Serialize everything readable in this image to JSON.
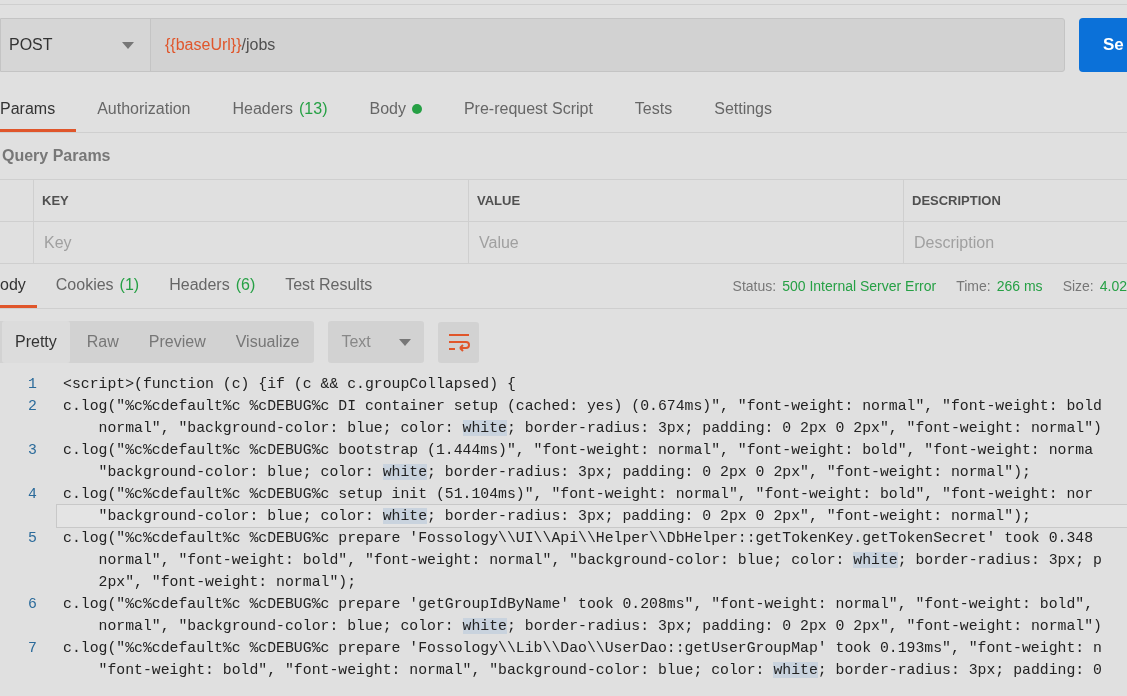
{
  "request": {
    "method": "POST",
    "url_variable": "{{baseUrl}}",
    "url_path": "/jobs",
    "send_label": "Se"
  },
  "request_tabs": [
    {
      "label": "Params",
      "selected": true
    },
    {
      "label": "Authorization",
      "selected": false
    },
    {
      "label": "Headers",
      "count": "(13)",
      "selected": false
    },
    {
      "label": "Body",
      "dot": true,
      "selected": false
    },
    {
      "label": "Pre-request Script",
      "selected": false
    },
    {
      "label": "Tests",
      "selected": false
    },
    {
      "label": "Settings",
      "selected": false
    }
  ],
  "query_params": {
    "title": "Query Params",
    "columns": [
      "KEY",
      "VALUE",
      "DESCRIPTION"
    ],
    "placeholders": [
      "Key",
      "Value",
      "Description"
    ]
  },
  "response_tabs": [
    {
      "label": "ody",
      "selected": true
    },
    {
      "label": "Cookies",
      "count": "(1)",
      "selected": false
    },
    {
      "label": "Headers",
      "count": "(6)",
      "selected": false
    },
    {
      "label": "Test Results",
      "selected": false
    }
  ],
  "status": [
    {
      "label": "Status:",
      "value": "500 Internal Server Error"
    },
    {
      "label": "Time:",
      "value": "266 ms"
    },
    {
      "label": "Size:",
      "value": "4.02"
    }
  ],
  "view_modes": [
    {
      "label": "Pretty",
      "selected": true
    },
    {
      "label": "Raw",
      "selected": false
    },
    {
      "label": "Preview",
      "selected": false
    },
    {
      "label": "Visualize",
      "selected": false
    }
  ],
  "format": "Text",
  "code": [
    {
      "number": "1",
      "rows": [
        {
          "parts": [
            "<script>(function (c) {if (c && c.groupCollapsed) {"
          ]
        }
      ]
    },
    {
      "number": "2",
      "rows": [
        {
          "parts": [
            "c.log(\"%c%cdefault%c %cDEBUG%c DI container setup (cached: yes) (0.674ms)\", \"font-weight: normal\", \"font-weight: bold"
          ]
        },
        {
          "parts": [
            "    normal\", \"background-color: blue; color: ",
            "white",
            "; border-radius: 3px; padding: 0 2px 0 2px\", \"font-weight: normal\")"
          ]
        }
      ]
    },
    {
      "number": "3",
      "rows": [
        {
          "parts": [
            "c.log(\"%c%cdefault%c %cDEBUG%c bootstrap (1.444ms)\", \"font-weight: normal\", \"font-weight: bold\", \"font-weight: norma"
          ]
        },
        {
          "parts": [
            "    \"background-color: blue; color: ",
            "white",
            "; border-radius: 3px; padding: 0 2px 0 2px\", \"font-weight: normal\");"
          ]
        }
      ]
    },
    {
      "number": "4",
      "rows": [
        {
          "parts": [
            "c.log(\"%c%cdefault%c %cDEBUG%c setup init (51.104ms)\", \"font-weight: normal\", \"font-weight: bold\", \"font-weight: nor"
          ]
        },
        {
          "parts": [
            "    \"background-color: blue; color: ",
            "white",
            "; border-radius: 3px; padding: 0 2px 0 2px\", \"font-weight: normal\");"
          ],
          "current": true
        }
      ]
    },
    {
      "number": "5",
      "rows": [
        {
          "parts": [
            "c.log(\"%c%cdefault%c %cDEBUG%c prepare 'Fossology\\\\UI\\\\Api\\\\Helper\\\\DbHelper::getTokenKey.getTokenSecret' took 0.348"
          ]
        },
        {
          "parts": [
            "    normal\", \"font-weight: bold\", \"font-weight: normal\", \"background-color: blue; color: ",
            "white",
            "; border-radius: 3px; p"
          ]
        },
        {
          "parts": [
            "    2px\", \"font-weight: normal\");"
          ]
        }
      ]
    },
    {
      "number": "6",
      "rows": [
        {
          "parts": [
            "c.log(\"%c%cdefault%c %cDEBUG%c prepare 'getGroupIdByName' took 0.208ms\", \"font-weight: normal\", \"font-weight: bold\","
          ]
        },
        {
          "parts": [
            "    normal\", \"background-color: blue; color: ",
            "white",
            "; border-radius: 3px; padding: 0 2px 0 2px\", \"font-weight: normal\")"
          ]
        }
      ]
    },
    {
      "number": "7",
      "rows": [
        {
          "parts": [
            "c.log(\"%c%cdefault%c %cDEBUG%c prepare 'Fossology\\\\Lib\\\\Dao\\\\UserDao::getUserGroupMap' took 0.193ms\", \"font-weight: n"
          ]
        },
        {
          "parts": [
            "    \"font-weight: bold\", \"font-weight: normal\", \"background-color: blue; color: ",
            "white",
            "; border-radius: 3px; padding: 0"
          ]
        }
      ]
    }
  ]
}
